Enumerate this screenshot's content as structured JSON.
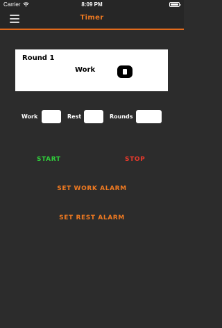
{
  "status_bar": {
    "carrier": "Carrier",
    "time": "8:09 PM"
  },
  "nav": {
    "title": "Timer",
    "menu_icon": "hamburger-menu-icon"
  },
  "round_card": {
    "round_label": "Round 1",
    "phase_label": "Work",
    "control_icon": "stop-icon"
  },
  "fields": {
    "work_label": "Work",
    "work_value": "",
    "rest_label": "Rest",
    "rest_value": "",
    "rounds_label": "Rounds",
    "rounds_value": ""
  },
  "actions": {
    "start_label": "START",
    "stop_label": "STOP",
    "set_work_alarm_label": "SET WORK ALARM",
    "set_rest_alarm_label": "SET REST ALARM"
  },
  "colors": {
    "accent": "#f07a21",
    "start": "#2fcc3a",
    "stop": "#e8392b",
    "background": "#2c2c2c"
  }
}
